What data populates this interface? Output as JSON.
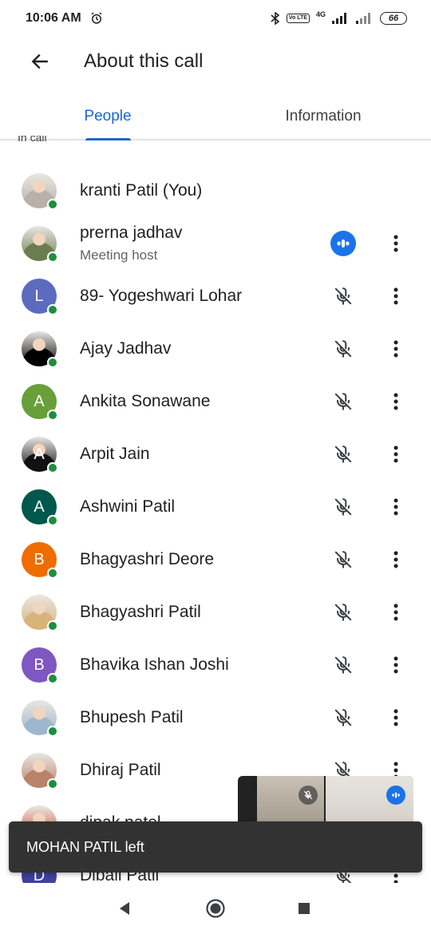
{
  "status": {
    "time": "10:06 AM",
    "network": "4G",
    "volte": "Vo LTE",
    "battery": "66"
  },
  "app_bar": {
    "title": "About this call"
  },
  "tabs": [
    {
      "label": "People"
    },
    {
      "label": "Information"
    }
  ],
  "section_label": "In call",
  "participants": [
    {
      "name": "kranti Patil (You)",
      "subtitle": "",
      "initial": "",
      "avatar_color": "#b7b1a9",
      "photo": true,
      "mic": "none"
    },
    {
      "name": "prerna jadhav",
      "subtitle": "Meeting host",
      "initial": "",
      "avatar_color": "#6b7d4f",
      "photo": true,
      "mic": "speaking"
    },
    {
      "name": "89- Yogeshwari Lohar",
      "subtitle": "",
      "initial": "L",
      "avatar_color": "#5c6bc0",
      "photo": false,
      "mic": "muted"
    },
    {
      "name": "Ajay Jadhav",
      "subtitle": "",
      "initial": "",
      "avatar_color": "#000000",
      "photo": true,
      "mic": "muted"
    },
    {
      "name": "Ankita Sonawane",
      "subtitle": "",
      "initial": "A",
      "avatar_color": "#689f38",
      "photo": false,
      "mic": "muted"
    },
    {
      "name": "Arpit Jain",
      "subtitle": "",
      "initial": "A",
      "avatar_color": "#111111",
      "photo": true,
      "mic": "muted"
    },
    {
      "name": "Ashwini Patil",
      "subtitle": "",
      "initial": "A",
      "avatar_color": "#00574b",
      "photo": false,
      "mic": "muted"
    },
    {
      "name": "Bhagyashri Deore",
      "subtitle": "",
      "initial": "B",
      "avatar_color": "#ef6c00",
      "photo": false,
      "mic": "muted"
    },
    {
      "name": "Bhagyashri Patil",
      "subtitle": "",
      "initial": "",
      "avatar_color": "#d8b47a",
      "photo": true,
      "mic": "muted"
    },
    {
      "name": "Bhavika Ishan Joshi",
      "subtitle": "",
      "initial": "B",
      "avatar_color": "#7e57c2",
      "photo": false,
      "mic": "muted"
    },
    {
      "name": "Bhupesh Patil",
      "subtitle": "",
      "initial": "",
      "avatar_color": "#9fb7cc",
      "photo": true,
      "mic": "muted"
    },
    {
      "name": "Dhiraj Patil",
      "subtitle": "",
      "initial": "",
      "avatar_color": "#b9826b",
      "photo": true,
      "mic": "muted"
    },
    {
      "name": "dipak patel",
      "subtitle": "",
      "initial": "",
      "avatar_color": "#d44a3a",
      "photo": true,
      "mic": "muted"
    },
    {
      "name": "Dibali Patil",
      "subtitle": "",
      "initial": "D",
      "avatar_color": "#3f3f9f",
      "photo": false,
      "mic": "muted"
    }
  ],
  "snackbar": {
    "message": "MOHAN PATIL left"
  },
  "colors": {
    "accent": "#1967d2",
    "online": "#1e8e3e",
    "speaking": "#1a73e8"
  },
  "icons": {
    "back": "arrow-left-icon",
    "more": "more-vert-icon",
    "muted": "mic-off-icon",
    "speaking": "speaking-icon"
  }
}
